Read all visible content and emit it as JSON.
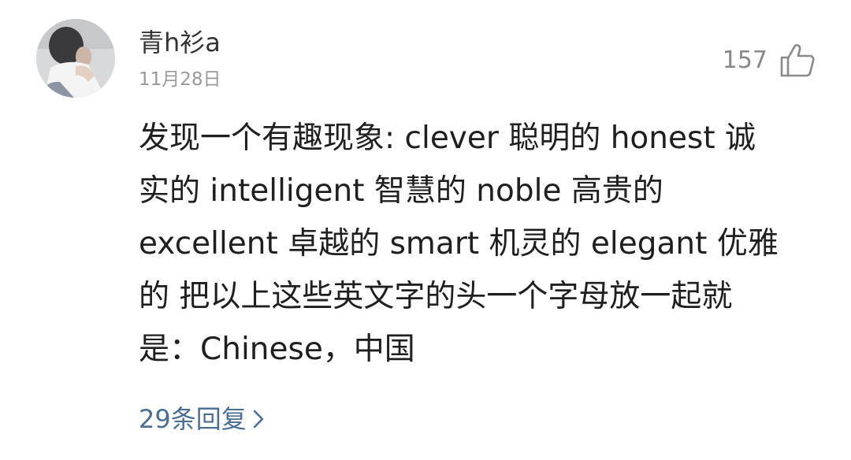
{
  "comment": {
    "username": "青h衫a",
    "date": "11月28日",
    "likes": "157",
    "content_lines": [
      "发现一个有趣现象: clever 聪明的 honest 诚",
      "实的 intelligent 智慧的 noble 高贵的",
      "excellent 卓越的 smart 机灵的 elegant 优雅",
      "的 把以上这些英文字的头一个字母放一起就",
      "是：Chinese，中国"
    ],
    "replies_label": "29条回复",
    "reply_color": "#4a6e95",
    "icons": {
      "like": "thumbs-up-icon",
      "replies": "chevron-right-icon"
    }
  }
}
